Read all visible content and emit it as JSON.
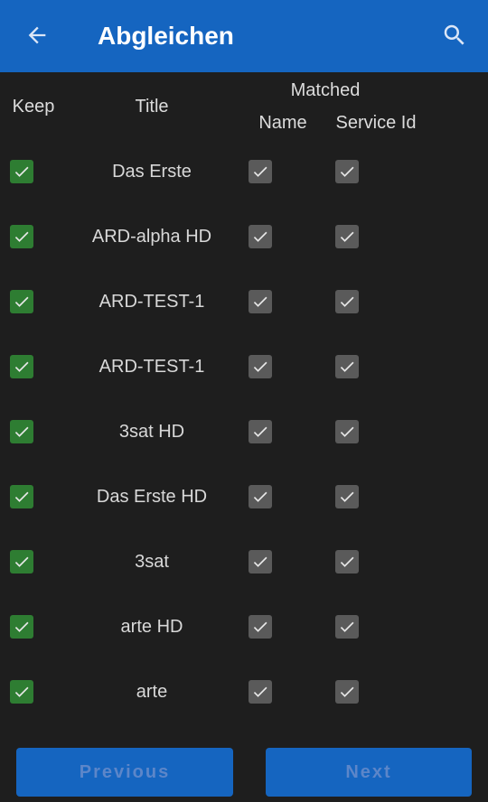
{
  "appbar": {
    "title": "Abgleichen",
    "back_icon": "arrow-left-icon",
    "search_icon": "search-icon",
    "color": "#1565c0"
  },
  "headers": {
    "keep": "Keep",
    "title": "Title",
    "matched": "Matched",
    "name": "Name",
    "service_id": "Service Id"
  },
  "rows": [
    {
      "title": "Das Erste",
      "keep": true,
      "name_matched": true,
      "service_id_matched": true
    },
    {
      "title": "ARD-alpha HD",
      "keep": true,
      "name_matched": true,
      "service_id_matched": true
    },
    {
      "title": "ARD-TEST-1",
      "keep": true,
      "name_matched": true,
      "service_id_matched": true
    },
    {
      "title": "ARD-TEST-1",
      "keep": true,
      "name_matched": true,
      "service_id_matched": true
    },
    {
      "title": "3sat HD",
      "keep": true,
      "name_matched": true,
      "service_id_matched": true
    },
    {
      "title": "Das Erste HD",
      "keep": true,
      "name_matched": true,
      "service_id_matched": true
    },
    {
      "title": "3sat",
      "keep": true,
      "name_matched": true,
      "service_id_matched": true
    },
    {
      "title": "arte HD",
      "keep": true,
      "name_matched": true,
      "service_id_matched": true
    },
    {
      "title": "arte",
      "keep": true,
      "name_matched": true,
      "service_id_matched": true
    }
  ],
  "footer": {
    "previous_label": "Previous",
    "next_label": "Next"
  },
  "colors": {
    "keep_checked": "#2e7d32",
    "matched_checked": "#5a5a5a",
    "background": "#1e1e1e"
  }
}
